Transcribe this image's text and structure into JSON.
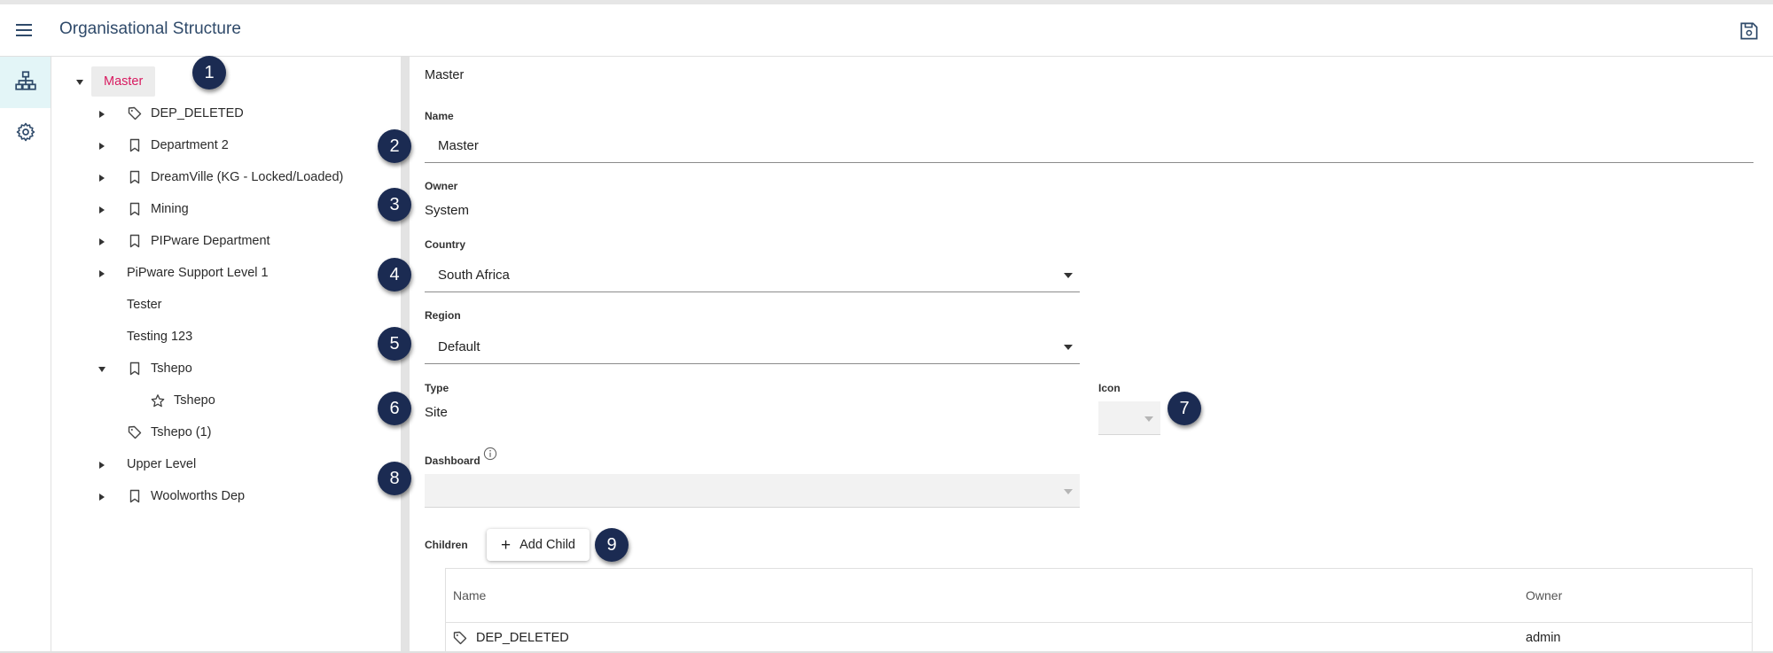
{
  "header": {
    "title": "Organisational Structure",
    "menu_icon": "hamburger-menu-icon",
    "save_icon": "save-icon"
  },
  "rail": {
    "items": [
      {
        "icon": "org-structure-icon",
        "active": true
      },
      {
        "icon": "gear-icon",
        "active": false
      }
    ]
  },
  "tree": {
    "root": "Master",
    "items": [
      {
        "label": "DEP_DELETED",
        "icon": "tag-icon",
        "expander": "collapsed"
      },
      {
        "label": "Department 2",
        "icon": "bookmark-icon",
        "expander": "collapsed"
      },
      {
        "label": "DreamVille (KG - Locked/Loaded)",
        "icon": "bookmark-icon",
        "expander": "collapsed"
      },
      {
        "label": "Mining",
        "icon": "bookmark-icon",
        "expander": "collapsed"
      },
      {
        "label": "PIPware Department",
        "icon": "bookmark-icon",
        "expander": "collapsed"
      },
      {
        "label": "PiPware Support Level 1",
        "icon": "",
        "expander": "collapsed"
      },
      {
        "label": "Tester",
        "icon": "",
        "expander": "none"
      },
      {
        "label": "Testing 123",
        "icon": "",
        "expander": "none"
      },
      {
        "label": "Tshepo",
        "icon": "bookmark-icon",
        "expander": "expanded"
      },
      {
        "label": "Tshepo",
        "icon": "star-icon",
        "expander": "none"
      },
      {
        "label": "Tshepo (1)",
        "icon": "tag-icon",
        "expander": "none"
      },
      {
        "label": "Upper Level",
        "icon": "",
        "expander": "collapsed"
      },
      {
        "label": "Woolworths Dep",
        "icon": "bookmark-icon",
        "expander": "collapsed"
      }
    ]
  },
  "badges": [
    "1",
    "2",
    "3",
    "4",
    "5",
    "6",
    "7",
    "8",
    "9"
  ],
  "form": {
    "breadcrumb": "Master",
    "name_label": "Name",
    "name_value": "Master",
    "owner_label": "Owner",
    "owner_value": "System",
    "country_label": "Country",
    "country_value": "South Africa",
    "region_label": "Region",
    "region_value": "Default",
    "type_label": "Type",
    "type_value": "Site",
    "icon_label": "Icon",
    "dashboard_label": "Dashboard",
    "children_label": "Children",
    "add_child_label": "Add Child"
  },
  "children_table": {
    "headers": [
      "Name",
      "Owner"
    ],
    "rows": [
      {
        "name": "DEP_DELETED",
        "owner": "admin",
        "icon": "tag-icon"
      }
    ]
  },
  "colors": {
    "accent": "#d81b60",
    "title": "#2f4a6a",
    "badge": "#1b2b52",
    "rail_active": "#e3f5f7"
  }
}
